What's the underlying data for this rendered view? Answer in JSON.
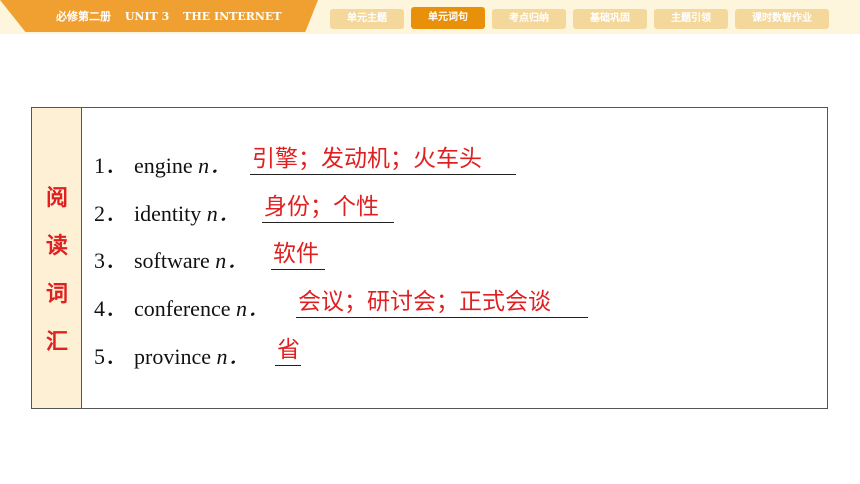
{
  "header": {
    "book": "必修第二册",
    "unit": "UNIT 3",
    "topic": "THE INTERNET"
  },
  "nav": [
    {
      "label": "单元主题",
      "active": false
    },
    {
      "label": "单元词句",
      "active": true
    },
    {
      "label": "考点归纳",
      "active": false
    },
    {
      "label": "基础巩固",
      "active": false
    },
    {
      "label": "主题引领",
      "active": false
    },
    {
      "label": "课时数智作业",
      "active": false
    }
  ],
  "section_label": [
    "阅",
    "读",
    "词",
    "汇"
  ],
  "items": [
    {
      "num": "1．",
      "word": "engine",
      "pos": "n．",
      "answer": "引擎；发动机；火车头"
    },
    {
      "num": "2．",
      "word": "identity",
      "pos": "n．",
      "answer": "身份；个性"
    },
    {
      "num": "3．",
      "word": "software",
      "pos": "n．",
      "answer": "软件"
    },
    {
      "num": "4．",
      "word": "conference",
      "pos": "n．",
      "answer": "会议；研讨会；正式会谈"
    },
    {
      "num": "5．",
      "word": "province",
      "pos": "n．",
      "answer": "省"
    }
  ],
  "colors": {
    "accent": "#f0a030",
    "nav_inactive": "#f4d79a",
    "nav_active": "#e8900a",
    "answer": "#e02020",
    "header_bg": "#fdf6dc",
    "label_bg": "#fdf0d5"
  }
}
